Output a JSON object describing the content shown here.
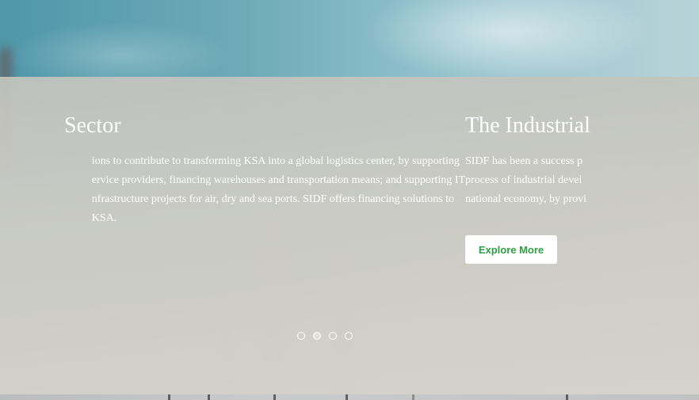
{
  "slides": [
    {
      "title": "Sector",
      "lines": [
        "ions to contribute to transforming KSA into a global logistics center, by supporting",
        "ervice providers, financing warehouses and transportation means; and supporting IT",
        "nfrastructure projects for air, dry and sea ports. SIDF offers financing solutions to",
        "KSA."
      ]
    },
    {
      "title": "The Industrial",
      "lines": [
        "SIDF has been a success p",
        "process of industrial devel",
        "national economy, by provi"
      ],
      "button_label": "Explore More"
    }
  ],
  "carousel": {
    "dot_count": 4,
    "active_index": 1
  }
}
